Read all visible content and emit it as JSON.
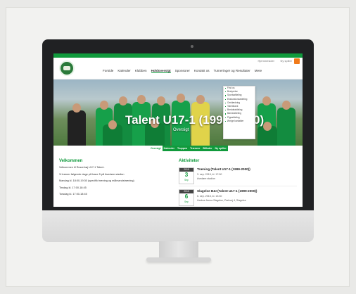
{
  "util": {
    "link1": "Hjemmesider",
    "link2": "Ny spiller"
  },
  "nav": [
    "Forside",
    "Kalender",
    "Klubben",
    "Holdoversigt",
    "Sponsorer",
    "Kontakt os",
    "Turneringer og Resultater",
    "Mere"
  ],
  "nav_active": "Holdoversigt",
  "hero": {
    "title": "Talent U17-1 (1999-2000)",
    "subtitle": "Oversigt"
  },
  "dropdown": [
    "Find os",
    "Bestyrelse",
    "Sportsafdeling",
    "Ekskursionsafdeling",
    "Omklædning",
    "Talentbank",
    "Breddeafdeling",
    "Børneafdeling",
    "Pigeafdeling",
    "Øvrige kontakter"
  ],
  "subnav": [
    "Oversigt",
    "Kalender",
    "Truppen",
    "Trænere",
    "Billeder",
    "Ny spiller"
  ],
  "welcome": {
    "heading": "Velkommen",
    "lines": [
      "Velkommen til Rosenhøj U17-1 Talent.",
      "Vi træner følgende dage på bane 5 på Avedøre stadion",
      "Mandag kl. 18:00-19:30 (specifik træning og målmandstræning)",
      "Tirsdag kl. 17:00-18:45",
      "Torsdag kl. 17:00-18:45"
    ]
  },
  "activities": {
    "heading": "Aktiviteter",
    "items": [
      {
        "year": "2015",
        "day": "3",
        "month": "Sep",
        "title": "Træning (Talent U17-1 (1999-2000))",
        "when": "3. sep. 2015, kl. 17:00",
        "where": "Avedøre stadion"
      },
      {
        "year": "2015",
        "day": "6",
        "month": "Sep",
        "title": "Slagelse B&I (Talent U17-1 (1999-2000))",
        "when": "6. sep. 2015, kl. 13:30",
        "where": "Harboe Arena Slagelse, Parkvej 4, Slagelse"
      }
    ]
  },
  "colors": {
    "brand": "#109a3c",
    "rss": "#f07a1a",
    "bezel": "#202123"
  }
}
